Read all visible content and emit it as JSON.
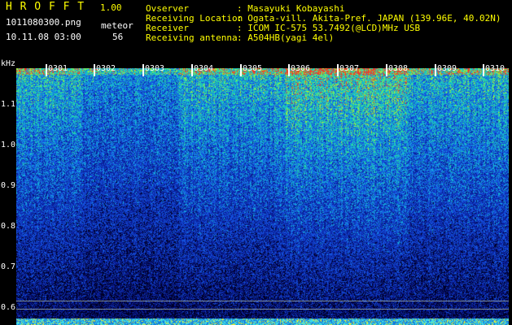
{
  "header": {
    "app_title": "H R O F F T",
    "version": "1.00",
    "filename": "1011080300.png",
    "datetime": "10.11.08 03:00",
    "meteor_label": "meteor",
    "meteor_count": "56",
    "info": [
      {
        "label": "Ovserver",
        "value": ": Masayuki Kobayashi"
      },
      {
        "label": "Receiving Location",
        "value": ": Ogata-vill. Akita-Pref. JAPAN (139.96E, 40.02N)"
      },
      {
        "label": "Receiver",
        "value": ": ICOM IC-575 53.7492(@LCD)MHz USB"
      },
      {
        "label": "Receiving antenna",
        "value": ": A504HB(yagi 4el)"
      }
    ]
  },
  "spectrogram": {
    "y_unit": "kHz",
    "y_ticks": [
      "1.1",
      "1.0",
      "0.9",
      "0.8",
      "0.7",
      "0.6"
    ],
    "x_ticks": [
      "0301",
      "0302",
      "0303",
      "0304",
      "0305",
      "0306",
      "0307",
      "0308",
      "0309",
      "0310"
    ]
  }
}
